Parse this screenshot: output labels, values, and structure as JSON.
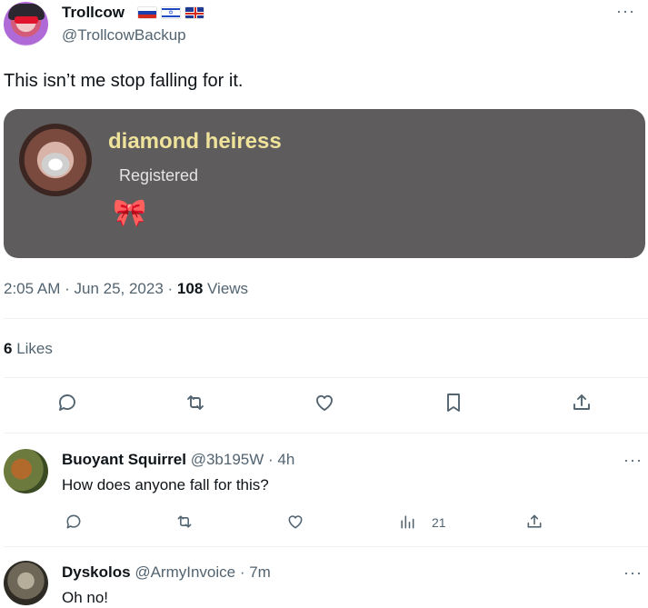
{
  "tweet": {
    "display_name": "Trollcow",
    "flags": [
      "russia-flag",
      "israel-flag",
      "uk-flag"
    ],
    "handle": "@TrollcowBackup",
    "text": "This isn’t me stop falling for it.",
    "card": {
      "name": "diamond heiress",
      "subtitle": "Registered",
      "emoji": "🎀"
    },
    "time": "2:05 AM",
    "date": "Jun 25, 2023",
    "views_count": "108",
    "views_label": "Views",
    "likes_count": "6",
    "likes_label": "Likes",
    "more": "···"
  },
  "replies": [
    {
      "display_name": "Buoyant Squirrel",
      "handle": "@3b195W · 4h",
      "text": "How does anyone fall for this?",
      "views": "21",
      "more": "···"
    },
    {
      "display_name": "Dyskolos",
      "handle": "@ArmyInvoice · 7m",
      "text": "Oh no!",
      "more": "···"
    }
  ],
  "colors": {
    "card_bg": "#5e5c5d",
    "card_name": "#efe29a",
    "muted": "#536471"
  }
}
